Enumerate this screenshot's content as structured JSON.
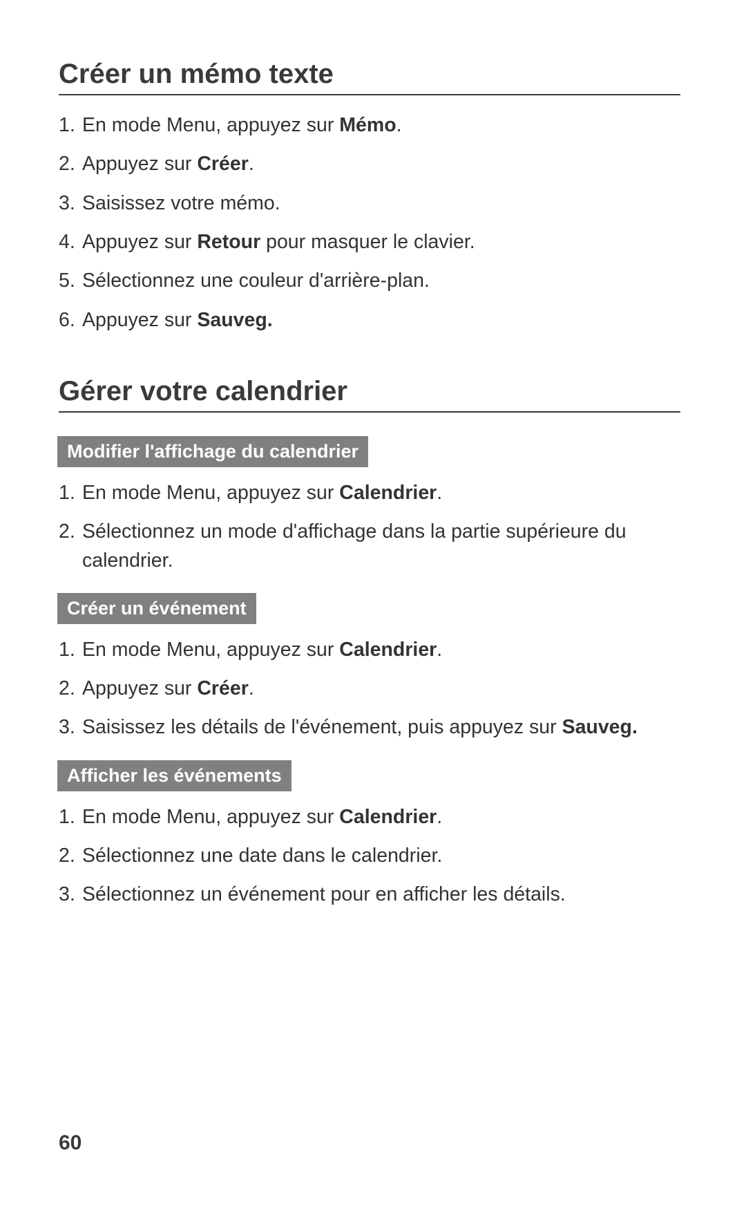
{
  "page_number": "60",
  "section1": {
    "title": "Créer un mémo texte",
    "steps": [
      {
        "pre": "En mode Menu, appuyez sur ",
        "bold": "Mémo",
        "post": "."
      },
      {
        "pre": "Appuyez sur ",
        "bold": "Créer",
        "post": "."
      },
      {
        "pre": "Saisissez votre mémo.",
        "bold": "",
        "post": ""
      },
      {
        "pre": "Appuyez sur ",
        "bold": "Retour",
        "post": " pour masquer le clavier."
      },
      {
        "pre": "Sélectionnez une couleur d'arrière-plan.",
        "bold": "",
        "post": ""
      },
      {
        "pre": "Appuyez sur ",
        "bold": "Sauveg.",
        "post": ""
      }
    ]
  },
  "section2": {
    "title": "Gérer votre calendrier",
    "sub1": {
      "title": "Modifier l'affichage du calendrier",
      "steps": [
        {
          "pre": "En mode Menu, appuyez sur ",
          "bold": "Calendrier",
          "post": "."
        },
        {
          "pre": "Sélectionnez un mode d'affichage dans la partie supérieure du calendrier.",
          "bold": "",
          "post": ""
        }
      ]
    },
    "sub2": {
      "title": "Créer un événement",
      "steps": [
        {
          "pre": "En mode Menu, appuyez sur ",
          "bold": "Calendrier",
          "post": "."
        },
        {
          "pre": "Appuyez sur ",
          "bold": "Créer",
          "post": "."
        },
        {
          "pre": "Saisissez les détails de l'événement, puis appuyez sur ",
          "bold": "Sauveg.",
          "post": ""
        }
      ]
    },
    "sub3": {
      "title": "Afficher les événements",
      "steps": [
        {
          "pre": "En mode Menu, appuyez sur ",
          "bold": "Calendrier",
          "post": "."
        },
        {
          "pre": "Sélectionnez une date dans le calendrier.",
          "bold": "",
          "post": ""
        },
        {
          "pre": "Sélectionnez un événement pour en afficher les détails.",
          "bold": "",
          "post": ""
        }
      ]
    }
  }
}
